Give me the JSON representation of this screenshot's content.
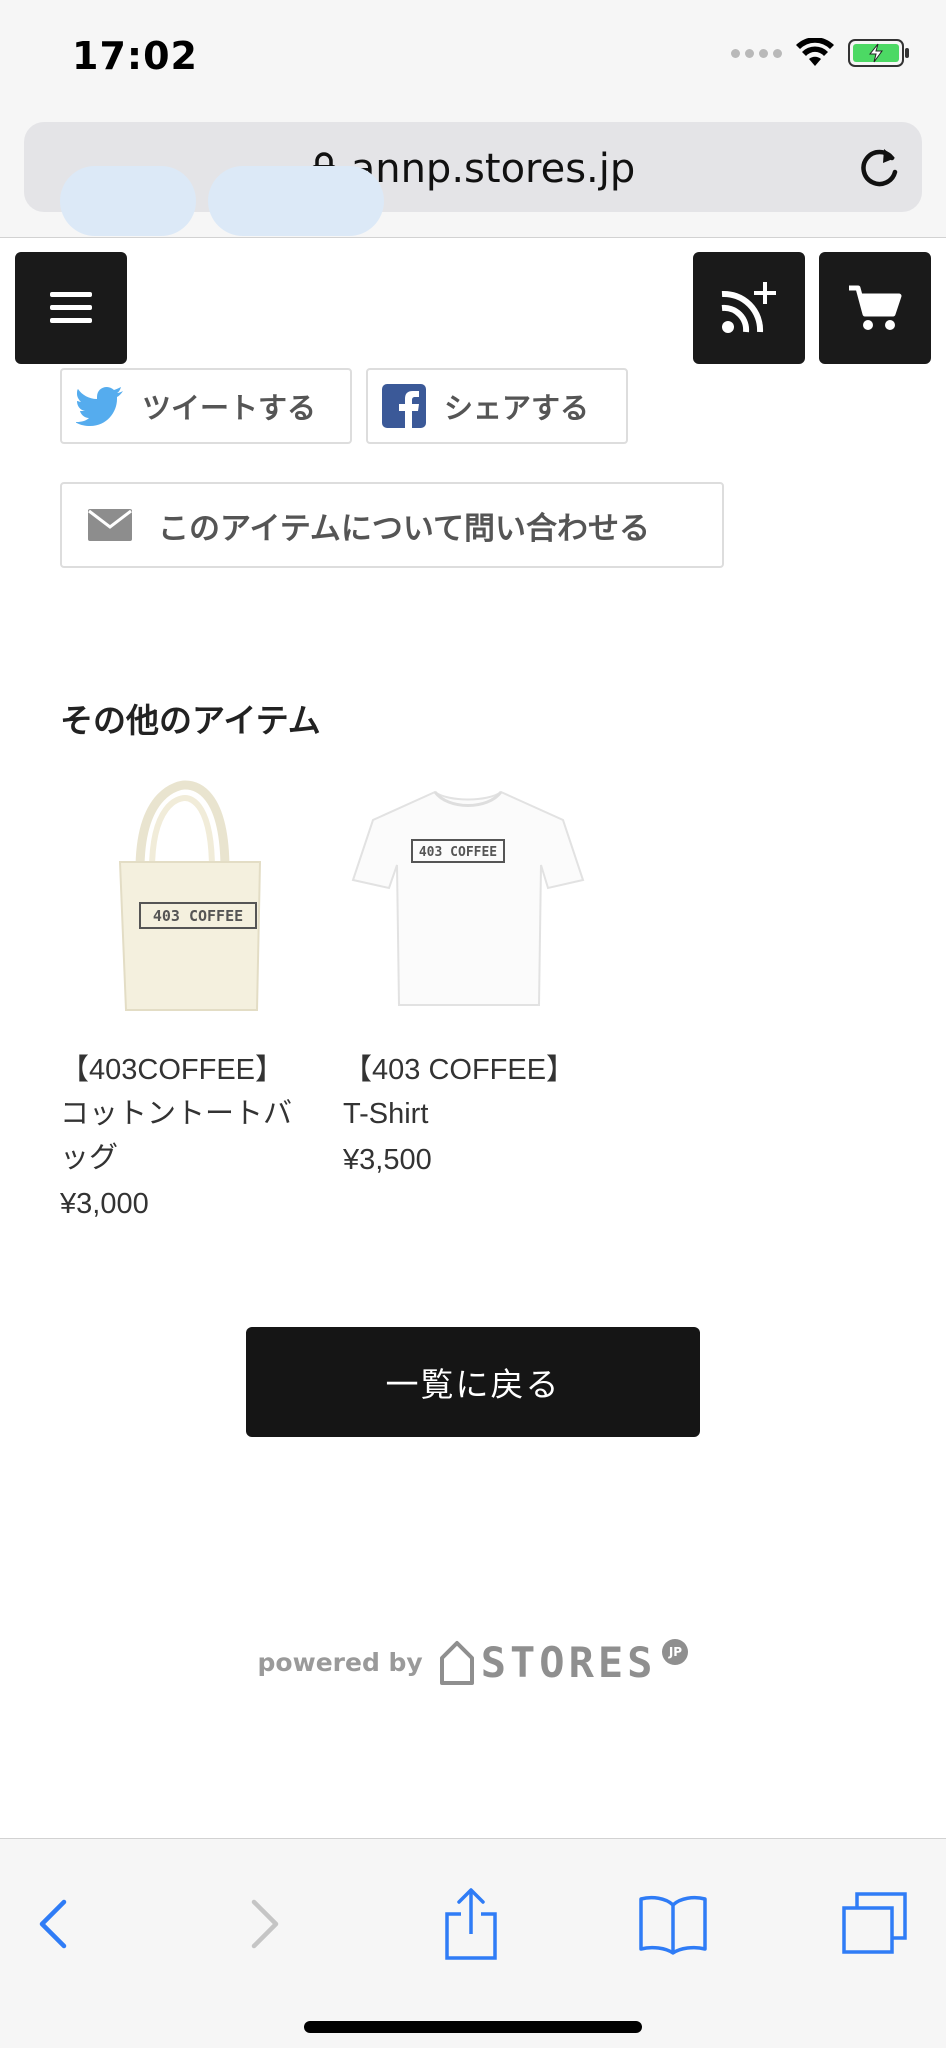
{
  "status_bar": {
    "time": "17:02"
  },
  "browser": {
    "url": "annp.stores.jp"
  },
  "share": {
    "tweet_label": "ツイートする",
    "facebook_label": "シェアする"
  },
  "inquiry": {
    "label": "このアイテムについて問い合わせる"
  },
  "other_items": {
    "title": "その他のアイテム",
    "items": [
      {
        "name": "【403COFFEE】コットントートバッグ",
        "price": "¥3,000",
        "image_text": "403 COFFEE"
      },
      {
        "name": "【403 COFFEE】T-Shirt",
        "price": "¥3,500",
        "image_text": "403 COFFEE"
      }
    ]
  },
  "back_button": {
    "label": "一覧に戻る"
  },
  "footer": {
    "powered_by": "powered by",
    "brand": "STORES",
    "badge": "JP"
  },
  "colors": {
    "accent": "#1a1a1a",
    "tag_bg": "#dce9f7",
    "twitter": "#55acee",
    "facebook": "#3b5998",
    "link_blue": "#2f7cf6"
  }
}
